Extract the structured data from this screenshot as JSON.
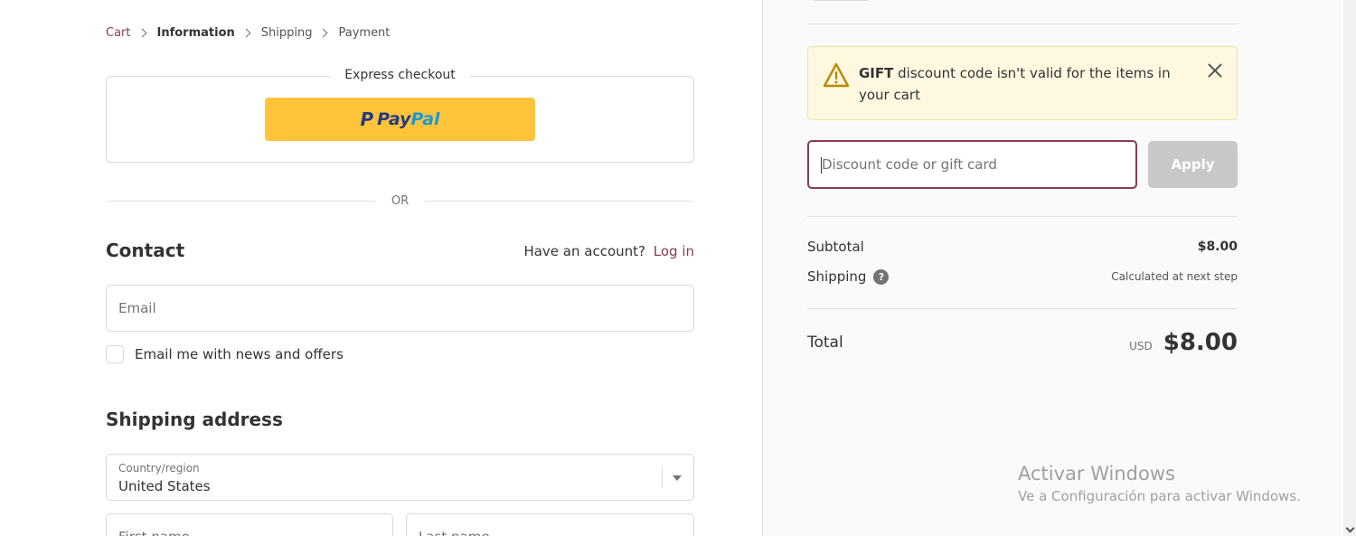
{
  "breadcrumb": {
    "cart": "Cart",
    "information": "Information",
    "shipping": "Shipping",
    "payment": "Payment"
  },
  "express": {
    "title": "Express checkout",
    "paypal_pay": "Pay",
    "paypal_pal": "Pal",
    "paypal_p": "P"
  },
  "divider": {
    "or": "OR"
  },
  "contact": {
    "heading": "Contact",
    "account_prompt": "Have an account?",
    "login_link": "Log in",
    "email_placeholder": "Email",
    "news_label": "Email me with news and offers"
  },
  "shipping_address": {
    "heading": "Shipping address",
    "country_label": "Country/region",
    "country_value": "United States",
    "first_name_placeholder": "First name",
    "last_name_placeholder": "Last name"
  },
  "alert": {
    "code": "GIFT",
    "message": "discount code isn't valid for the items in your cart"
  },
  "discount": {
    "placeholder": "Discount code or gift card",
    "apply_label": "Apply"
  },
  "summary": {
    "subtotal_label": "Subtotal",
    "subtotal_value": "$8.00",
    "shipping_label": "Shipping",
    "shipping_value": "Calculated at next step",
    "help_glyph": "?",
    "total_label": "Total",
    "currency": "USD",
    "total_value": "$8.00"
  },
  "watermark": {
    "title": "Activar Windows",
    "subtitle": "Ve a Configuración para activar Windows."
  },
  "icons": {
    "alert": "warning-triangle-icon",
    "close": "close-icon",
    "help": "question-circle-icon",
    "chevron": "chevron-right-icon"
  },
  "colors": {
    "accent": "#8b3a57",
    "paypal_yellow": "#ffc439",
    "paypal_dark_blue": "#253b80",
    "paypal_light_blue": "#179bd7",
    "alert_bg": "#fff8e1",
    "alert_icon": "#b98900",
    "apply_disabled": "#c8c8c8"
  }
}
